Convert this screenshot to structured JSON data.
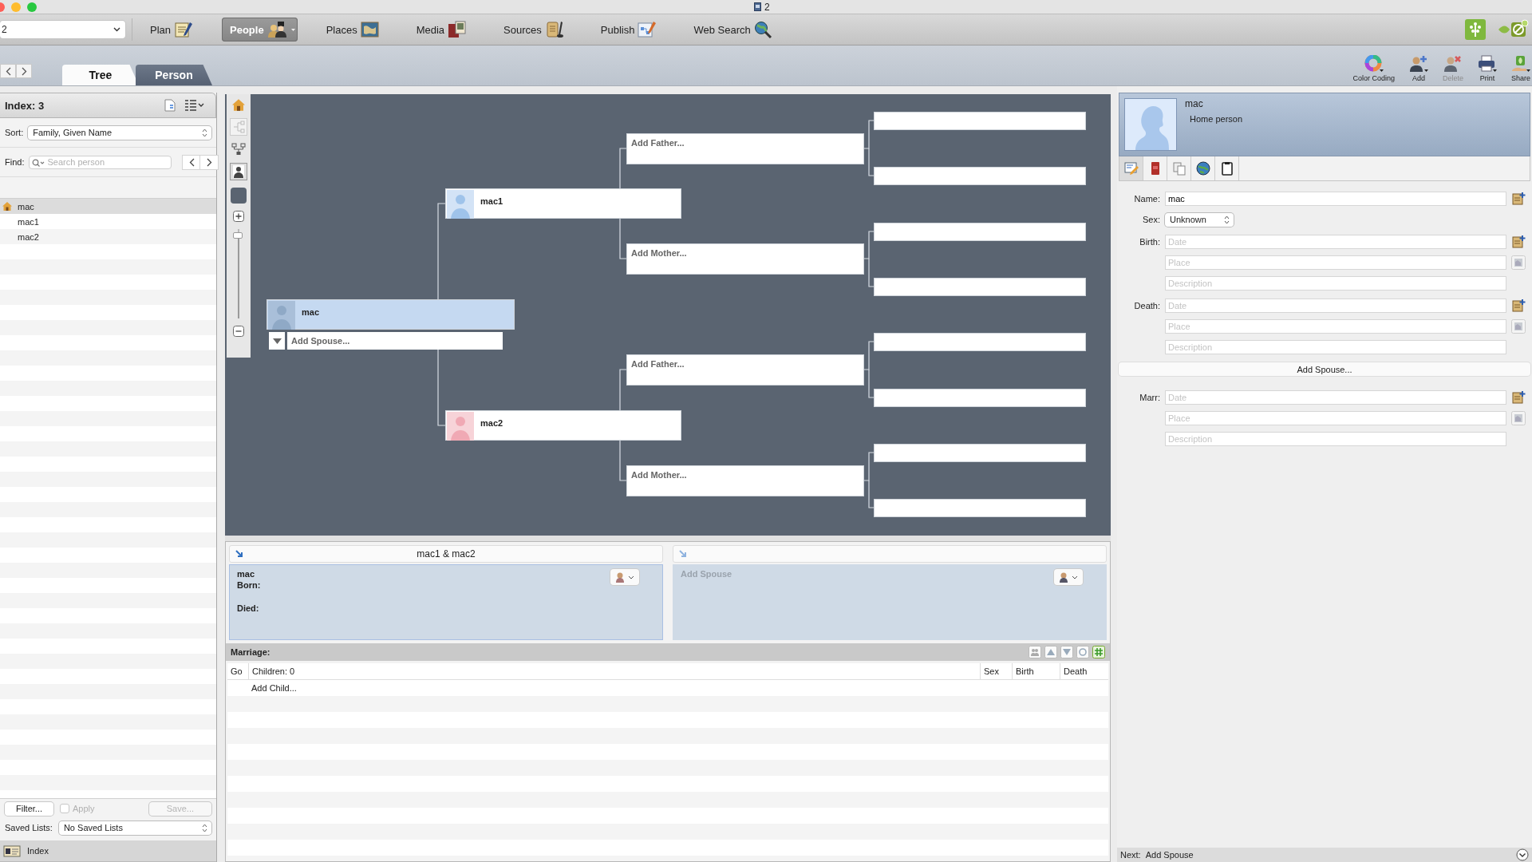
{
  "window": {
    "title": "2"
  },
  "toolbar": {
    "tree_selector": "2",
    "modules": [
      {
        "label": "Plan",
        "kind": "plan",
        "selected": false
      },
      {
        "label": "People",
        "kind": "people",
        "selected": true
      },
      {
        "label": "Places",
        "kind": "places",
        "selected": false
      },
      {
        "label": "Media",
        "kind": "media",
        "selected": false
      },
      {
        "label": "Sources",
        "kind": "sources",
        "selected": false
      },
      {
        "label": "Publish",
        "kind": "publish",
        "selected": false
      },
      {
        "label": "Web Search",
        "kind": "web_search",
        "selected": false
      }
    ]
  },
  "view_tabs": [
    {
      "label": "Tree",
      "selected": true
    },
    {
      "label": "Person",
      "selected": false
    }
  ],
  "actions": [
    {
      "label": "Color Coding",
      "kind": "color",
      "disabled": false
    },
    {
      "label": "Add",
      "kind": "add",
      "disabled": false
    },
    {
      "label": "Delete",
      "kind": "delete",
      "disabled": true
    },
    {
      "label": "Print",
      "kind": "print",
      "disabled": false
    },
    {
      "label": "Share",
      "kind": "share",
      "disabled": false
    }
  ],
  "sidebar": {
    "title": "Index: 3",
    "sort_label": "Sort:",
    "sort_value": "Family, Given Name",
    "find_label": "Find:",
    "find_placeholder": "Search person",
    "people": [
      {
        "name": "mac",
        "home": true,
        "selected": true
      },
      {
        "name": "mac1",
        "home": false,
        "selected": false
      },
      {
        "name": "mac2",
        "home": false,
        "selected": false
      }
    ],
    "filter_button": "Filter...",
    "apply": {
      "label": "Apply",
      "checked": false,
      "disabled": true
    },
    "save_button": {
      "label": "Save...",
      "disabled": true
    },
    "saved_lists_label": "Saved Lists:",
    "saved_lists_value": "No Saved Lists",
    "footer": "Index"
  },
  "tree": {
    "zoom": {
      "level": 0.93
    },
    "root": {
      "name": "mac",
      "kind": "unknown",
      "selected": true
    },
    "add_spouse": "Add Spouse...",
    "parents": [
      {
        "name": "mac1",
        "kind": "male",
        "selected": false,
        "grandparents": [
          {
            "label": "Add Father..."
          },
          {
            "label": "Add Mother..."
          }
        ]
      },
      {
        "name": "mac2",
        "kind": "female",
        "selected": false,
        "grandparents": [
          {
            "label": "Add Father..."
          },
          {
            "label": "Add Mother..."
          }
        ]
      }
    ]
  },
  "family": {
    "title": "mac1 & mac2",
    "person": {
      "name": "mac",
      "fields": [
        "Born:",
        "Died:"
      ]
    },
    "spouse_label": "Add Spouse",
    "marriage_label": "Marriage:",
    "columns": [
      "Go",
      "Children: 0",
      "Sex",
      "Birth",
      "Death"
    ],
    "rows": [
      "Add Child..."
    ]
  },
  "person_panel": {
    "name": "mac",
    "subtitle": "Home person",
    "kind": "unknown",
    "tabs": [
      {
        "kind": "edit",
        "selected": true
      },
      {
        "kind": "book",
        "selected": false
      },
      {
        "kind": "copy",
        "selected": false
      },
      {
        "kind": "globe",
        "selected": false
      },
      {
        "kind": "clipboard",
        "selected": false
      }
    ],
    "name_label": "Name:",
    "name_value": "mac",
    "sex_label": "Sex:",
    "sex_value": "Unknown",
    "events": [
      {
        "label": "Birth:",
        "fields": [
          {
            "kind": "date",
            "placeholder": "Date"
          },
          {
            "kind": "place",
            "placeholder": "Place"
          },
          {
            "kind": "description",
            "placeholder": "Description"
          }
        ]
      },
      {
        "label": "Death:",
        "fields": [
          {
            "kind": "date",
            "placeholder": "Date"
          },
          {
            "kind": "place",
            "placeholder": "Place"
          },
          {
            "kind": "description",
            "placeholder": "Description"
          }
        ]
      }
    ],
    "add_spouse": "Add Spouse...",
    "marriage": {
      "label": "Marr:",
      "fields": [
        {
          "kind": "date",
          "placeholder": "Date"
        },
        {
          "kind": "place",
          "placeholder": "Place"
        },
        {
          "kind": "description",
          "placeholder": "Description"
        }
      ]
    },
    "next_label": "Next:",
    "next_value": "Add Spouse"
  }
}
